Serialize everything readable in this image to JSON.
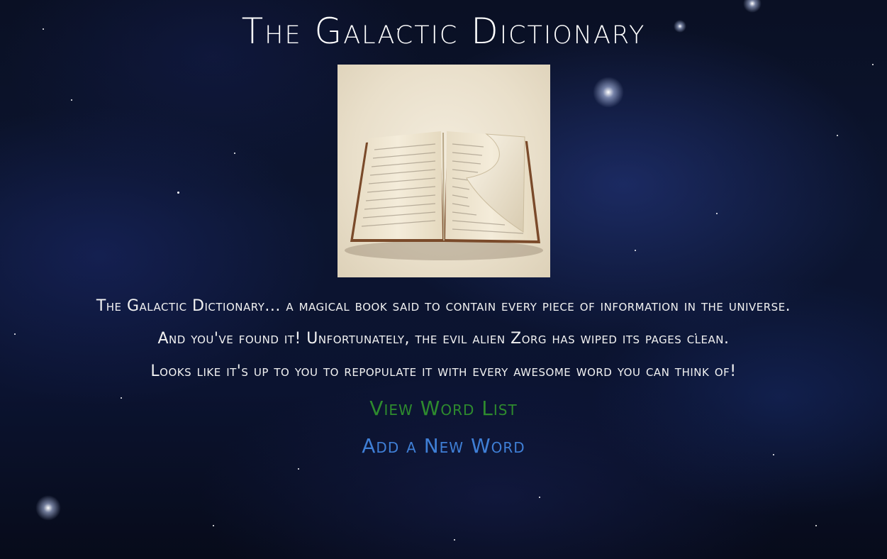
{
  "page": {
    "title": "The Galactic Dictionary",
    "hero_image_alt": "Open dictionary book"
  },
  "intro": {
    "lines": [
      "The Galactic Dictionary... a magical book said to contain every piece of information in the universe.",
      "And you've found it! Unfortunately, the evil alien Zorg has wiped its pages clean.",
      "Looks like it's up to you to repopulate it with every awesome word you can think of!"
    ]
  },
  "links": {
    "view_word_list": "View Word List",
    "add_new_word": "Add a New Word"
  },
  "colors": {
    "view_link": "#2e8b2e",
    "add_link": "#3f7fd6",
    "text": "#ffffff"
  }
}
